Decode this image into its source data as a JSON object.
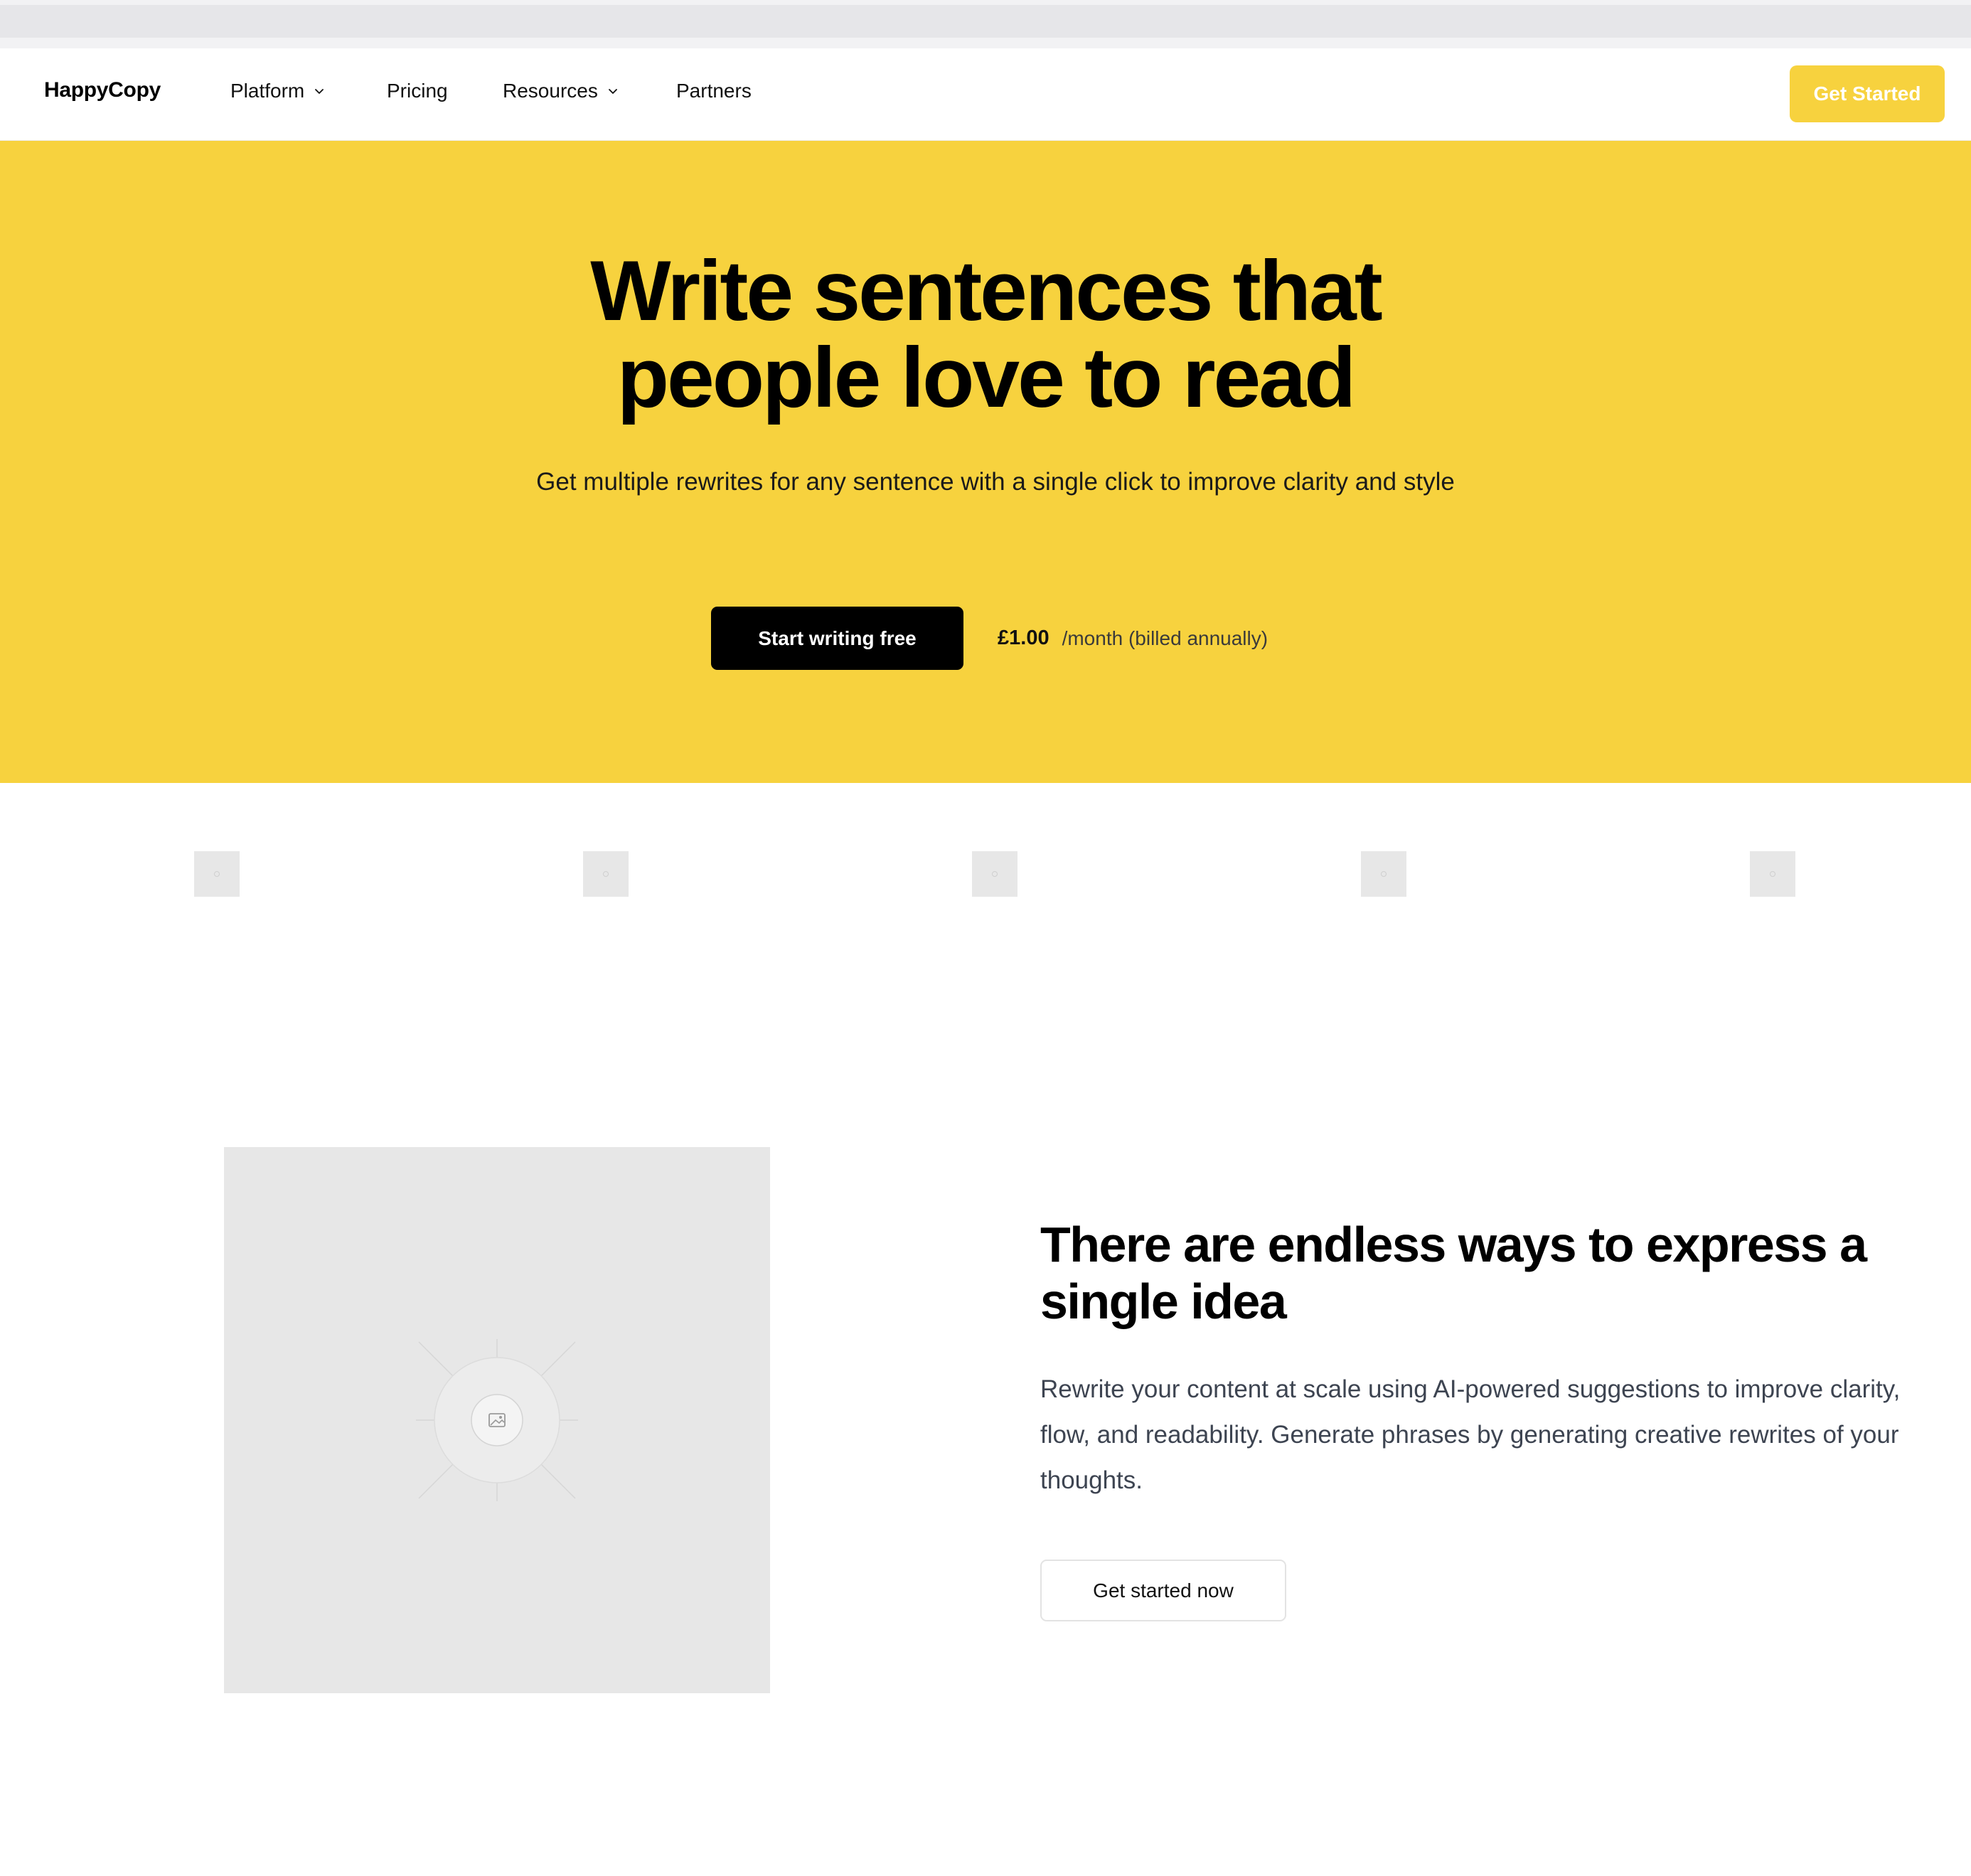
{
  "nav": {
    "brand": "HappyCopy",
    "items": [
      {
        "label": "Platform",
        "has_dropdown": true,
        "icon": "chevron-down-icon"
      },
      {
        "label": "Pricing",
        "has_dropdown": false
      },
      {
        "label": "Resources",
        "has_dropdown": true,
        "icon": "chevron-down-icon"
      },
      {
        "label": "Partners",
        "has_dropdown": false
      }
    ],
    "cta_label": "Get Started"
  },
  "hero": {
    "title_line1": "Write sentences that",
    "title_line2": "people love to read",
    "subtitle": "Get multiple rewrites for any sentence with a single click to improve clarity and style",
    "cta_label": "Start writing free",
    "price": "£1.00",
    "price_note": "/month (billed annually)"
  },
  "logos": {
    "count": 5,
    "icon": "image-placeholder-icon"
  },
  "feature": {
    "image_icon": "image-placeholder-icon",
    "title": "There are endless ways to express a single idea",
    "text": "Rewrite your content at scale using AI-powered suggestions to improve clarity, flow, and readability. Generate phrases by generating creative rewrites of your thoughts.",
    "cta_label": "Get started now"
  },
  "colors": {
    "brand_yellow": "#f7d23e",
    "primary_button": "#000000",
    "placeholder_gray": "#e7e7e7",
    "body_text": "#3d4451"
  }
}
